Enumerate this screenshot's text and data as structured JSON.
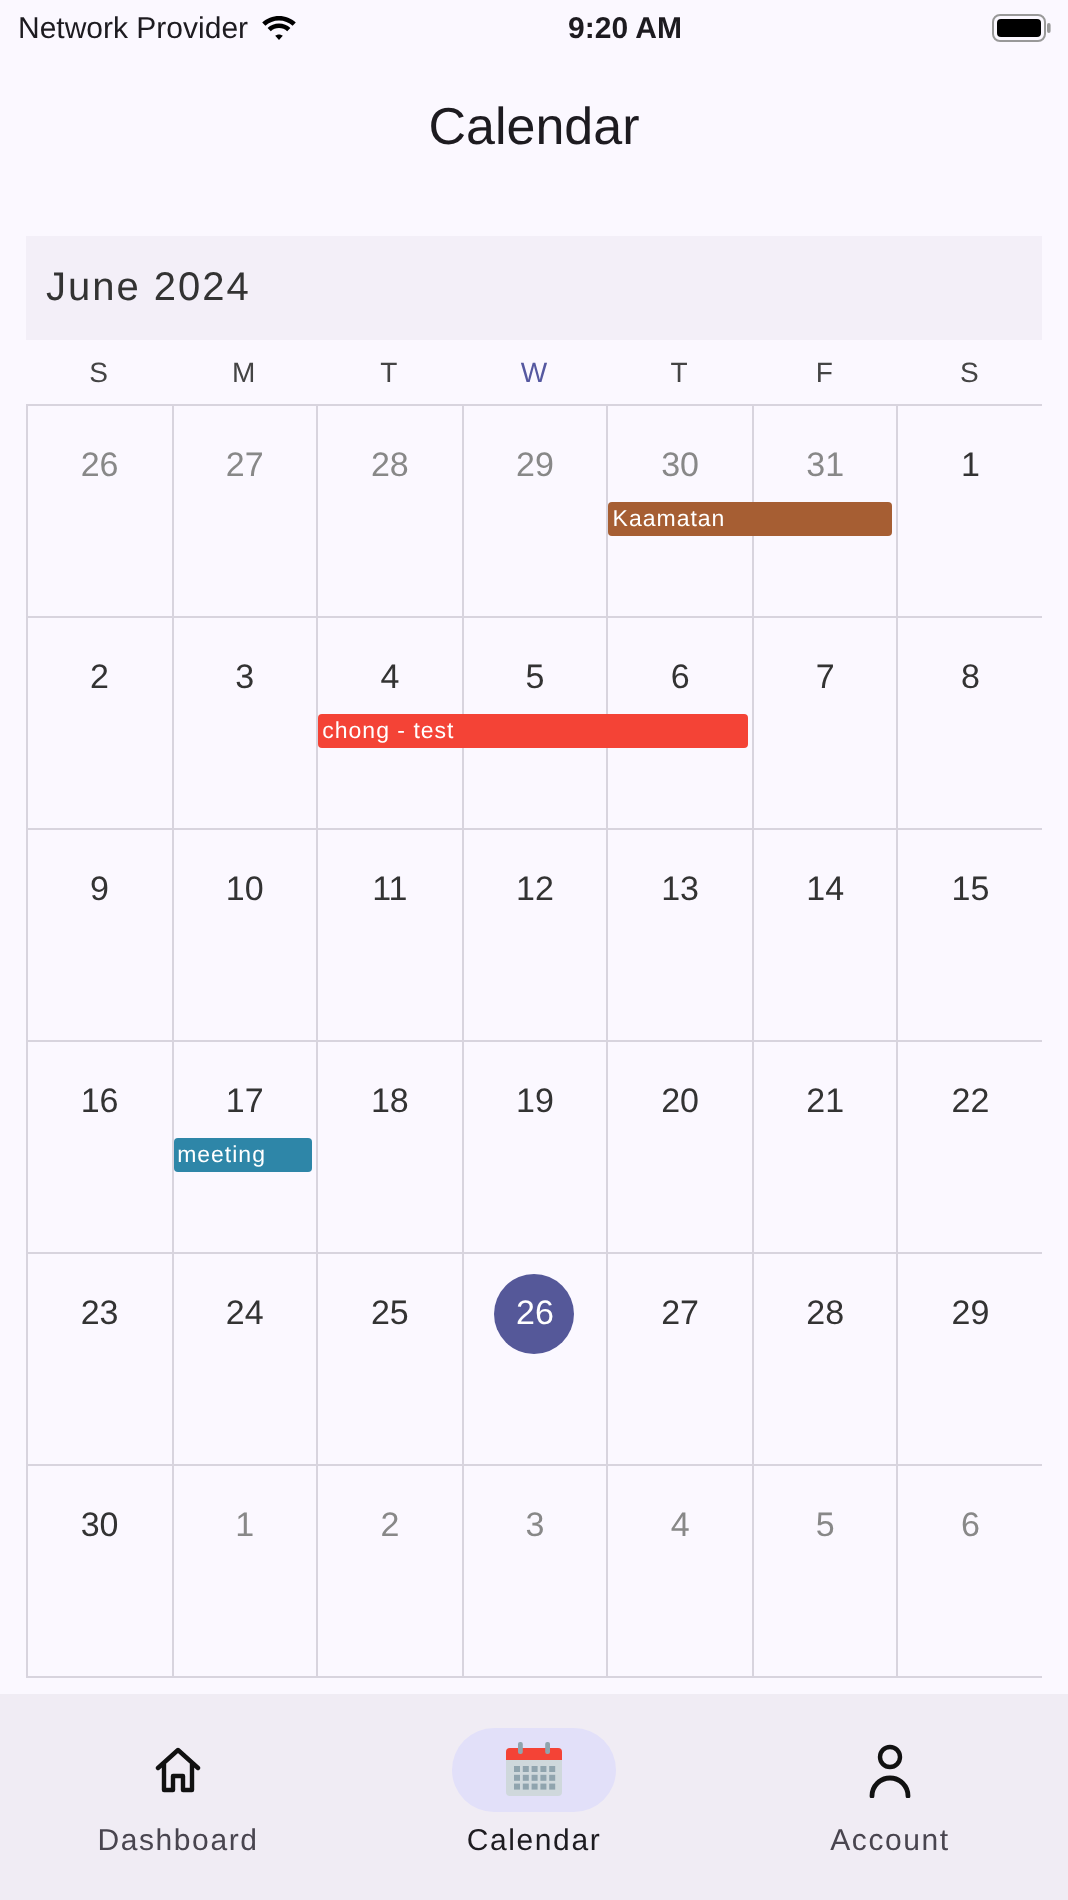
{
  "status_bar": {
    "carrier": "Network Provider",
    "time": "9:20 AM"
  },
  "title": "Calendar",
  "month": "June 2024",
  "weekdays": [
    {
      "label": "S",
      "selected": false
    },
    {
      "label": "M",
      "selected": false
    },
    {
      "label": "T",
      "selected": false
    },
    {
      "label": "W",
      "selected": true
    },
    {
      "label": "T",
      "selected": false
    },
    {
      "label": "F",
      "selected": false
    },
    {
      "label": "S",
      "selected": false
    }
  ],
  "weeks": [
    {
      "days": [
        {
          "day": "26",
          "outside": true,
          "selected": false
        },
        {
          "day": "27",
          "outside": true,
          "selected": false
        },
        {
          "day": "28",
          "outside": true,
          "selected": false
        },
        {
          "day": "29",
          "outside": true,
          "selected": false
        },
        {
          "day": "30",
          "outside": true,
          "selected": false,
          "event": {
            "label": "Kaamatan",
            "color": "#a65e33"
          }
        },
        {
          "day": "31",
          "outside": true,
          "selected": false,
          "event_continues": true
        },
        {
          "day": "1",
          "outside": false,
          "selected": false
        }
      ]
    },
    {
      "days": [
        {
          "day": "2",
          "outside": false,
          "selected": false
        },
        {
          "day": "3",
          "outside": false,
          "selected": false
        },
        {
          "day": "4",
          "outside": false,
          "selected": false,
          "event": {
            "label": "chong - test",
            "color": "#f44336"
          }
        },
        {
          "day": "5",
          "outside": false,
          "selected": false,
          "event_continues": true
        },
        {
          "day": "6",
          "outside": false,
          "selected": false,
          "event_continues": true
        },
        {
          "day": "7",
          "outside": false,
          "selected": false
        },
        {
          "day": "8",
          "outside": false,
          "selected": false
        }
      ]
    },
    {
      "days": [
        {
          "day": "9",
          "outside": false,
          "selected": false
        },
        {
          "day": "10",
          "outside": false,
          "selected": false
        },
        {
          "day": "11",
          "outside": false,
          "selected": false
        },
        {
          "day": "12",
          "outside": false,
          "selected": false
        },
        {
          "day": "13",
          "outside": false,
          "selected": false
        },
        {
          "day": "14",
          "outside": false,
          "selected": false
        },
        {
          "day": "15",
          "outside": false,
          "selected": false
        }
      ]
    },
    {
      "days": [
        {
          "day": "16",
          "outside": false,
          "selected": false
        },
        {
          "day": "17",
          "outside": false,
          "selected": false,
          "event": {
            "label": "meeting",
            "color": "#2e86a8"
          }
        },
        {
          "day": "18",
          "outside": false,
          "selected": false
        },
        {
          "day": "19",
          "outside": false,
          "selected": false
        },
        {
          "day": "20",
          "outside": false,
          "selected": false
        },
        {
          "day": "21",
          "outside": false,
          "selected": false
        },
        {
          "day": "22",
          "outside": false,
          "selected": false
        }
      ]
    },
    {
      "days": [
        {
          "day": "23",
          "outside": false,
          "selected": false
        },
        {
          "day": "24",
          "outside": false,
          "selected": false
        },
        {
          "day": "25",
          "outside": false,
          "selected": false
        },
        {
          "day": "26",
          "outside": false,
          "selected": true
        },
        {
          "day": "27",
          "outside": false,
          "selected": false
        },
        {
          "day": "28",
          "outside": false,
          "selected": false
        },
        {
          "day": "29",
          "outside": false,
          "selected": false
        }
      ]
    },
    {
      "days": [
        {
          "day": "30",
          "outside": false,
          "selected": false
        },
        {
          "day": "1",
          "outside": true,
          "selected": false
        },
        {
          "day": "2",
          "outside": true,
          "selected": false
        },
        {
          "day": "3",
          "outside": true,
          "selected": false
        },
        {
          "day": "4",
          "outside": true,
          "selected": false
        },
        {
          "day": "5",
          "outside": true,
          "selected": false
        },
        {
          "day": "6",
          "outside": true,
          "selected": false
        }
      ]
    }
  ],
  "nav": [
    {
      "label": "Dashboard",
      "kind": "home",
      "selected": false
    },
    {
      "label": "Calendar",
      "kind": "calendar",
      "selected": true
    },
    {
      "label": "Account",
      "kind": "person",
      "selected": false
    }
  ]
}
